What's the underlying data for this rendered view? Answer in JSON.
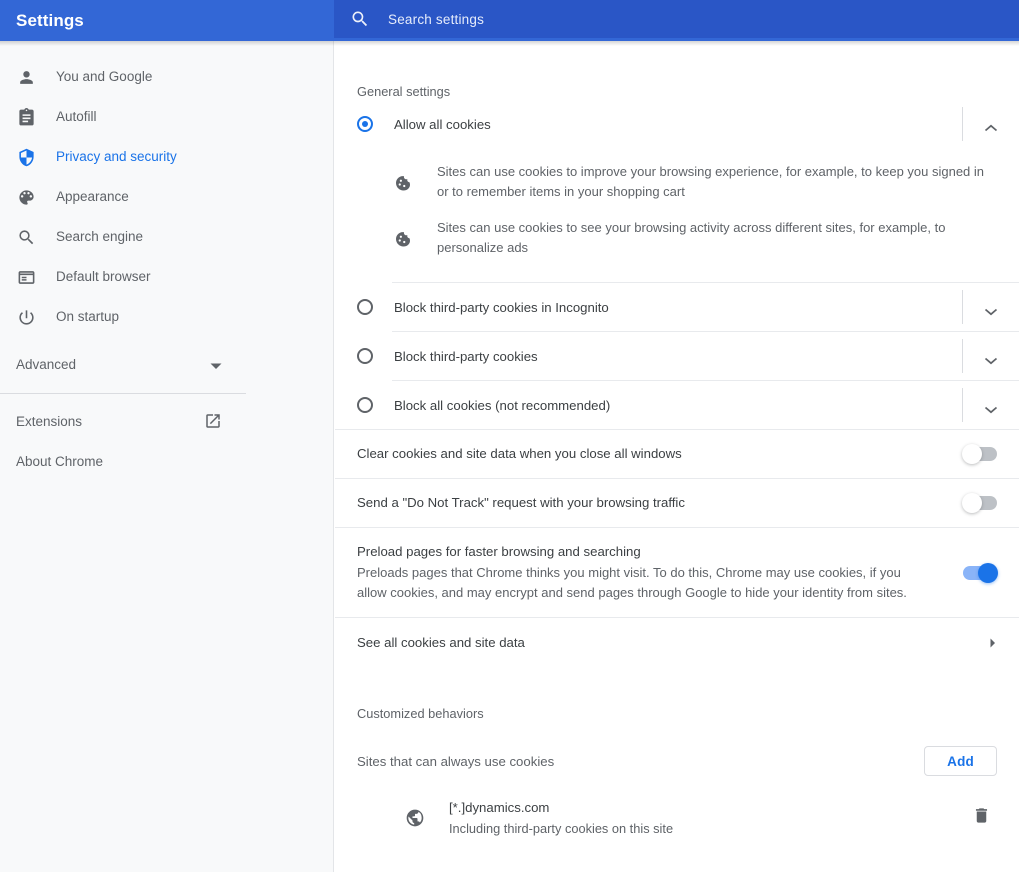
{
  "header": {
    "title": "Settings",
    "search_placeholder": "Search settings",
    "search_value": "",
    "search_icon": "search-icon",
    "bar_color": "#3367d6",
    "search_box_color": "#2a56c6"
  },
  "sidebar": {
    "items": [
      {
        "label": "You and Google",
        "icon": "person-icon",
        "active": false
      },
      {
        "label": "Autofill",
        "icon": "clipboard-icon",
        "active": false
      },
      {
        "label": "Privacy and security",
        "icon": "shield-icon",
        "active": true
      },
      {
        "label": "Appearance",
        "icon": "palette-icon",
        "active": false
      },
      {
        "label": "Search engine",
        "icon": "search-icon",
        "active": false
      },
      {
        "label": "Default browser",
        "icon": "browser-window-icon",
        "active": false
      },
      {
        "label": "On startup",
        "icon": "power-icon",
        "active": false
      }
    ],
    "advanced": {
      "label": "Advanced",
      "icon": "chevron-down-icon"
    },
    "footer": [
      {
        "label": "Extensions",
        "icon": "open-in-new-icon"
      },
      {
        "label": "About Chrome",
        "icon": ""
      }
    ],
    "active_color": "#1a73e8"
  },
  "main": {
    "general_settings_heading": "General settings",
    "cookie_options": [
      {
        "label": "Allow all cookies",
        "selected": true,
        "expanded": true,
        "chevron": "chevron-up-icon",
        "descriptions": [
          "Sites can use cookies to improve your browsing experience, for example, to keep you signed in or to remember items in your shopping cart",
          "Sites can use cookies to see your browsing activity across different sites, for example, to personalize ads"
        ]
      },
      {
        "label": "Block third-party cookies in Incognito",
        "selected": false,
        "expanded": false,
        "chevron": "chevron-down-icon",
        "descriptions": []
      },
      {
        "label": "Block third-party cookies",
        "selected": false,
        "expanded": false,
        "chevron": "chevron-down-icon",
        "descriptions": []
      },
      {
        "label": "Block all cookies (not recommended)",
        "selected": false,
        "expanded": false,
        "chevron": "chevron-down-icon",
        "descriptions": []
      }
    ],
    "toggles": [
      {
        "title": "Clear cookies and site data when you close all windows",
        "subtitle": "",
        "on": false
      },
      {
        "title": "Send a \"Do Not Track\" request with your browsing traffic",
        "subtitle": "",
        "on": false
      },
      {
        "title": "Preload pages for faster browsing and searching",
        "subtitle": "Preloads pages that Chrome thinks you might visit. To do this, Chrome may use cookies, if you allow cookies, and may encrypt and send pages through Google to hide your identity from sites.",
        "on": true
      }
    ],
    "see_all_cookies": {
      "label": "See all cookies and site data",
      "arrow": "chevron-right-icon"
    },
    "customized_behaviors_heading": "Customized behaviors",
    "sites_always_use_cookies": {
      "label": "Sites that can always use cookies",
      "add_button": "Add"
    },
    "site_entries": [
      {
        "name": "[*.]dynamics.com",
        "sub": "Including third-party cookies on this site",
        "icon": "globe-icon",
        "delete_icon": "trash-icon"
      }
    ]
  }
}
